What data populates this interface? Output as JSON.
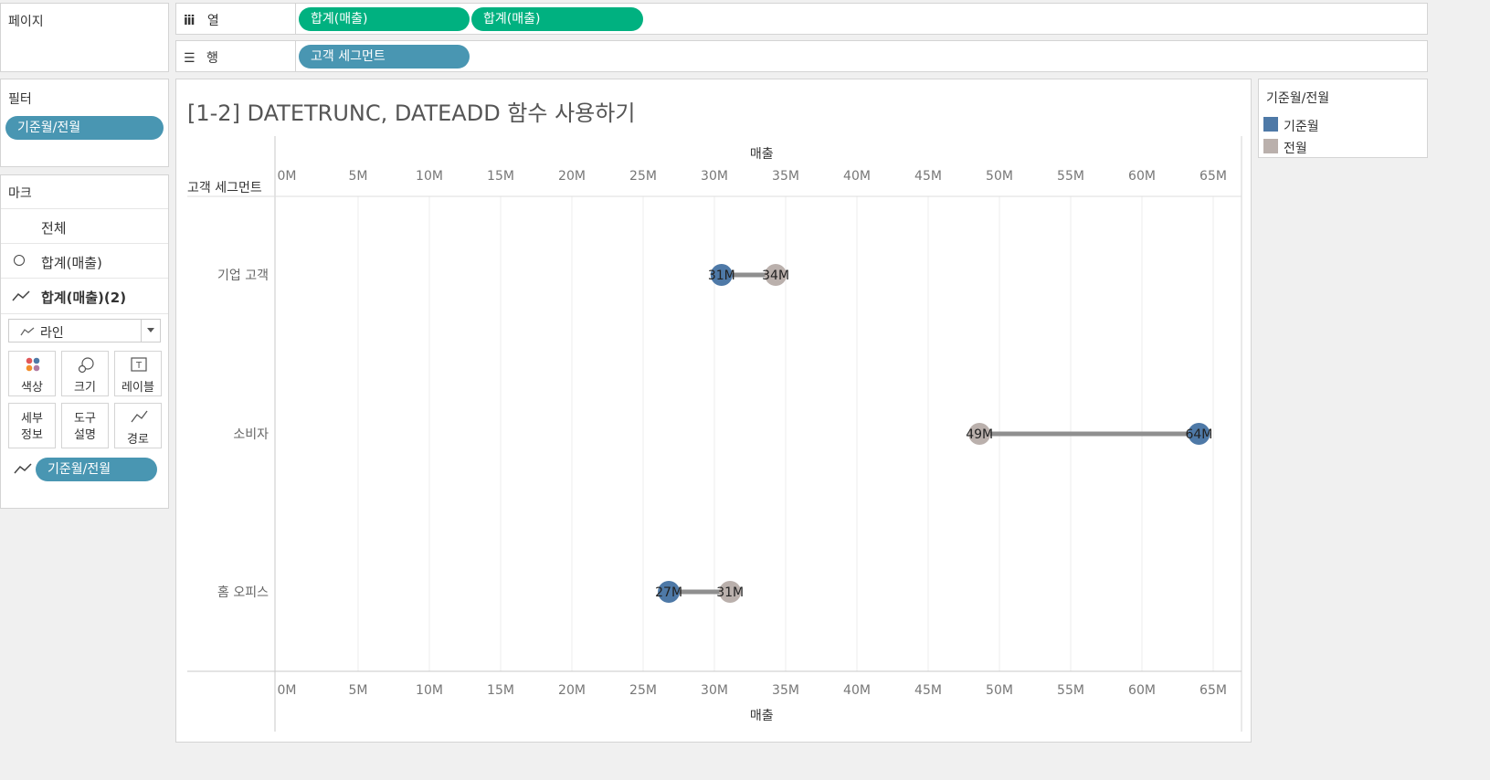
{
  "pages_panel": {
    "title": "페이지"
  },
  "shelves": {
    "columns": {
      "label": "열",
      "pills": [
        "합계(매출)",
        "합계(매출)"
      ]
    },
    "rows": {
      "label": "행",
      "pills": [
        "고객 세그먼트"
      ]
    }
  },
  "filters_panel": {
    "title": "필터",
    "pills": [
      "기준월/전월"
    ]
  },
  "marks_panel": {
    "title": "마크",
    "all_label": "전체",
    "layer1_label": "합계(매출)",
    "layer2_label": "합계(매출)(2)",
    "mark_type": "라인",
    "buttons": {
      "color": "색상",
      "size": "크기",
      "label": "레이블",
      "detail_line1": "세부",
      "detail_line2": "정보",
      "tooltip_line1": "도구",
      "tooltip_line2": "설명",
      "path": "경로"
    },
    "path_pill": "기준월/전월"
  },
  "legend": {
    "title": "기준월/전월",
    "items": [
      {
        "label": "기준월",
        "color": "#4e79a7"
      },
      {
        "label": "전월",
        "color": "#bab0ac"
      }
    ]
  },
  "colors": {
    "accent_green": "#00b180",
    "pill_blue": "#4996b2",
    "line_gray": "#8f8f8f"
  },
  "chart_data": {
    "type": "dumbbell",
    "title": "[1-2] DATETRUNC, DATEADD 함수 사용하기",
    "row_header": "고객 세그먼트",
    "xlabel_top": "매출",
    "xlabel_bottom": "매출",
    "xlim": [
      0,
      68000000
    ],
    "ticks": [
      0,
      5000000,
      10000000,
      15000000,
      20000000,
      25000000,
      30000000,
      35000000,
      40000000,
      45000000,
      50000000,
      55000000,
      60000000,
      65000000
    ],
    "tick_labels": [
      "0M",
      "5M",
      "10M",
      "15M",
      "20M",
      "25M",
      "30M",
      "35M",
      "40M",
      "45M",
      "50M",
      "55M",
      "60M",
      "65M"
    ],
    "grid": true,
    "categories": [
      "기업 고객",
      "소비자",
      "홈 오피스"
    ],
    "series": [
      {
        "name": "기준월",
        "values": [
          30500000,
          64000000,
          26800000
        ],
        "labels": [
          "31M",
          "64M",
          "27M"
        ]
      },
      {
        "name": "전월",
        "values": [
          34300000,
          48600000,
          31100000
        ],
        "labels": [
          "34M",
          "49M",
          "31M"
        ]
      }
    ]
  }
}
